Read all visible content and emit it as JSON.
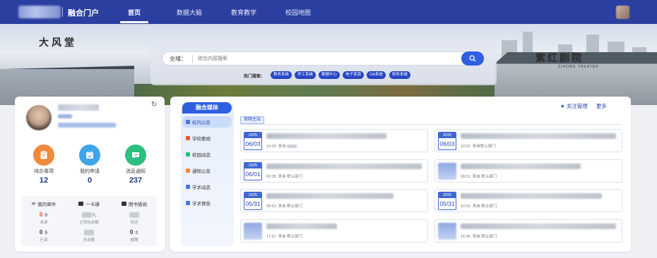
{
  "topnav": {
    "portal_name": "融合门户",
    "items": [
      {
        "label": "首页",
        "active": true
      },
      {
        "label": "数据大脑",
        "active": false
      },
      {
        "label": "教育教学",
        "active": false
      },
      {
        "label": "校园地图",
        "active": false
      }
    ]
  },
  "banner": {
    "left_sign": "大风堂",
    "right_sign": "紫红剧院",
    "right_sub": "ZIHONG THEATER"
  },
  "search": {
    "scope_label": "全域：",
    "placeholder": "综合内容搜索",
    "hot_label": "热门搜索：",
    "hot_tags": [
      "教务系统",
      "学工系统",
      "数据中心",
      "电子资源",
      "OA系统",
      "财务系统"
    ]
  },
  "user_panel": {
    "stats": [
      {
        "label": "待办事项",
        "value": "12",
        "color": "#f08a3c",
        "icon": "todo-icon"
      },
      {
        "label": "我的申请",
        "value": "0",
        "color": "#3fa4e8",
        "icon": "calendar-icon"
      },
      {
        "label": "消息通知",
        "value": "237",
        "color": "#2cbf7f",
        "icon": "message-icon"
      }
    ],
    "mini": [
      {
        "head": "我的邮件",
        "icon": "mail-icon",
        "big1": "0",
        "unit1": "条",
        "sub1": "未读",
        "big2": "0",
        "unit2": "条",
        "sub2": "已读"
      },
      {
        "head": "一卡通",
        "icon": "card-icon",
        "big1": "",
        "unit1": "元",
        "sub1": "主钱包余额",
        "big2": "",
        "unit2": "",
        "sub2": "总余额"
      },
      {
        "head": "图书借阅",
        "icon": "book-icon",
        "big1": "",
        "unit1": "",
        "sub1": "待还",
        "big2": "0",
        "unit2": "本",
        "sub2": "超期"
      }
    ]
  },
  "news": {
    "menu_title": "融合媒体",
    "menu": [
      {
        "label": "校内公告",
        "active": true,
        "color": "#4a78e0"
      },
      {
        "label": "学校要闻",
        "active": false,
        "color": "#e85a3c"
      },
      {
        "label": "校园动态",
        "active": false,
        "color": "#2cbf7f"
      },
      {
        "label": "通知公告",
        "active": false,
        "color": "#f08a3c"
      },
      {
        "label": "学术动态",
        "active": false,
        "color": "#4a78e0"
      },
      {
        "label": "学术预告",
        "active": false,
        "color": "#4a78e0"
      }
    ],
    "actions": [
      "关注管理",
      "更多"
    ],
    "tab": "官网主站",
    "items": [
      {
        "year": "2025",
        "day": "06/03",
        "time": "14:30",
        "source": "来自",
        "show_date": true
      },
      {
        "year": "2025",
        "day": "06/03",
        "time": "10:32",
        "source": "来自默认部门",
        "show_date": true
      },
      {
        "year": "2025",
        "day": "06/01",
        "time": "09:28",
        "source": "来自 默认部门",
        "show_date": true
      },
      {
        "year": "",
        "day": "",
        "time": "09:01",
        "source": "来自 默认部门",
        "show_date": false
      },
      {
        "year": "2025",
        "day": "05/31",
        "time": "08:53",
        "source": "来自 默认部门",
        "show_date": true
      },
      {
        "year": "2025",
        "day": "05/31",
        "time": "10:32",
        "source": "来自 默认部门",
        "show_date": true
      },
      {
        "year": "",
        "day": "",
        "time": "17:07",
        "source": "来自 默认部门",
        "show_date": false
      },
      {
        "year": "",
        "day": "",
        "time": "15:45",
        "source": "来自 默认部门",
        "show_date": false
      }
    ]
  }
}
